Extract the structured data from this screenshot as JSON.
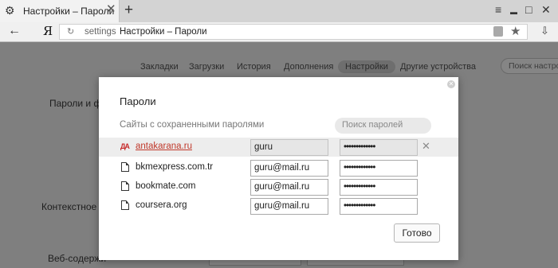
{
  "browser": {
    "tab_title": "Настройки – Пароли",
    "tab_close_glyph": "✕",
    "new_tab_glyph": "+",
    "menu_glyph": "≡",
    "minimize_glyph": "▬",
    "maximize_glyph": "□",
    "close_glyph": "✕",
    "back_glyph": "←",
    "logo_text": "Я",
    "reload_glyph": "↻",
    "url_scheme": "settings",
    "url_title": "Настройки – Пароли",
    "star_glyph": "★",
    "download_glyph": "⇩"
  },
  "settings_nav": {
    "items": [
      {
        "label": "Закладки"
      },
      {
        "label": "Загрузки"
      },
      {
        "label": "История"
      },
      {
        "label": "Дополнения"
      },
      {
        "label": "Настройки",
        "active": true
      },
      {
        "label": "Другие устройства"
      }
    ],
    "search_placeholder": "Поиск настро"
  },
  "page_sections": {
    "passwords_forms": "Пароли и фо",
    "context_menu": "Контекстное м",
    "web_content": "Веб-содержи"
  },
  "dialog": {
    "close_glyph": "✕",
    "title": "Пароли",
    "subtitle": "Сайты с сохраненными паролями",
    "search_placeholder": "Поиск паролей",
    "rows": [
      {
        "site": "antakarana.ru",
        "login": "guru",
        "password": "•••••••••••••",
        "highlighted": true,
        "remove_glyph": "✕",
        "logo_text": "ДА"
      },
      {
        "site": "bkmexpress.com.tr",
        "login": "guru@mail.ru",
        "password": "•••••••••••••"
      },
      {
        "site": "bookmate.com",
        "login": "guru@mail.ru",
        "password": "•••••••••••••"
      },
      {
        "site": "coursera.org",
        "login": "guru@mail.ru",
        "password": "•••••••••••••"
      }
    ],
    "done_label": "Готово"
  }
}
